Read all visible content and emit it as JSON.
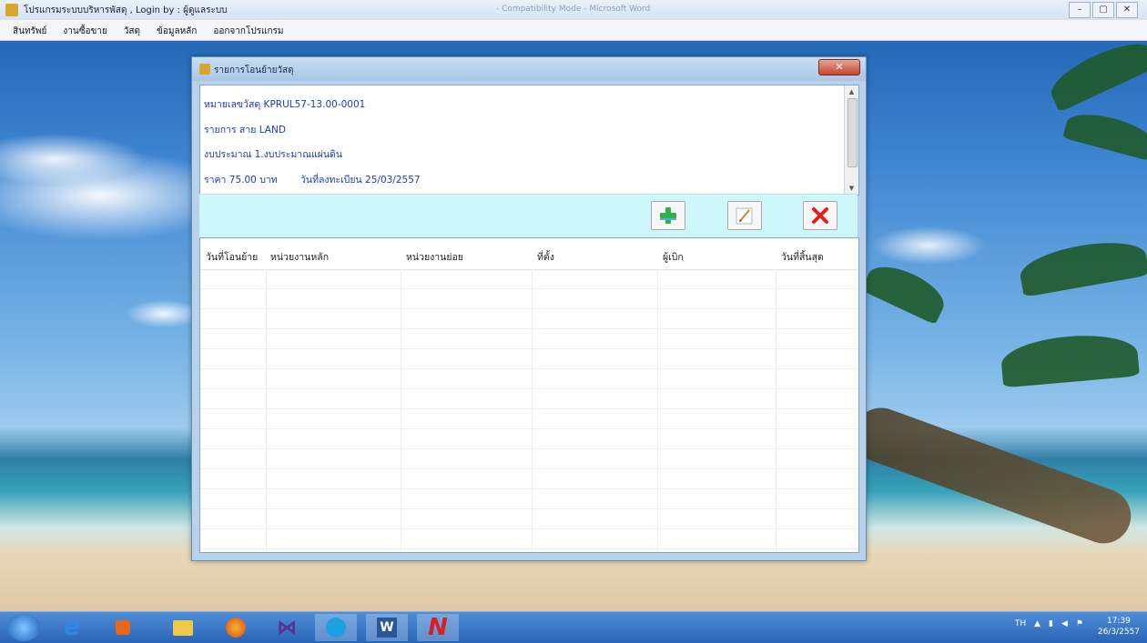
{
  "app": {
    "title": "โปรแกรมระบบบริหารพัสดุ , Login by : ผู้ดูแลระบบ",
    "center_title": "- Compatibility Mode - Microsoft Word",
    "controls": {
      "minimize": "–",
      "maximize": "▢",
      "close": "✕"
    }
  },
  "menubar": {
    "items": [
      "สินทรัพย์",
      "งานซื้อขาย",
      "วัสดุ",
      "ข้อมูลหลัก",
      "ออกจากโปรแกรม"
    ]
  },
  "dialog": {
    "title": "รายการโอนย้ายวัสดุ",
    "close_glyph": "✕",
    "info": {
      "line1": "หมายเลขวัสดุ KPRUL57-13.00-0001",
      "line2": "รายการ สาย LAND",
      "line3": "งบประมาณ 1.งบประมาณแผ่นดิน",
      "line4_price": "ราคา 75.00 บาท",
      "line4_date": "วันที่ลงทะเบียน 25/03/2557"
    },
    "toolbar": {
      "add_icon": "plus-icon",
      "edit_icon": "pencil-icon",
      "delete_icon": "delete-x-icon",
      "add_color": "#2db34a",
      "delete_color": "#e02020"
    },
    "grid": {
      "columns": [
        "วันที่โอนย้าย",
        "หน่วยงานหลัก",
        "หน่วยงานย่อย",
        "ที่ตั้ง",
        "ผู้เบิก",
        "วันที่สิ้นสุด"
      ],
      "rows": []
    }
  },
  "taskbar": {
    "apps": [
      "start-orb",
      "internet-explorer",
      "media-center",
      "file-explorer",
      "firefox",
      "mail",
      "skype",
      "word",
      "custom-app"
    ],
    "tray": {
      "lang": "TH"
    },
    "clock": {
      "time": "17:39",
      "date": "26/3/2557"
    }
  }
}
